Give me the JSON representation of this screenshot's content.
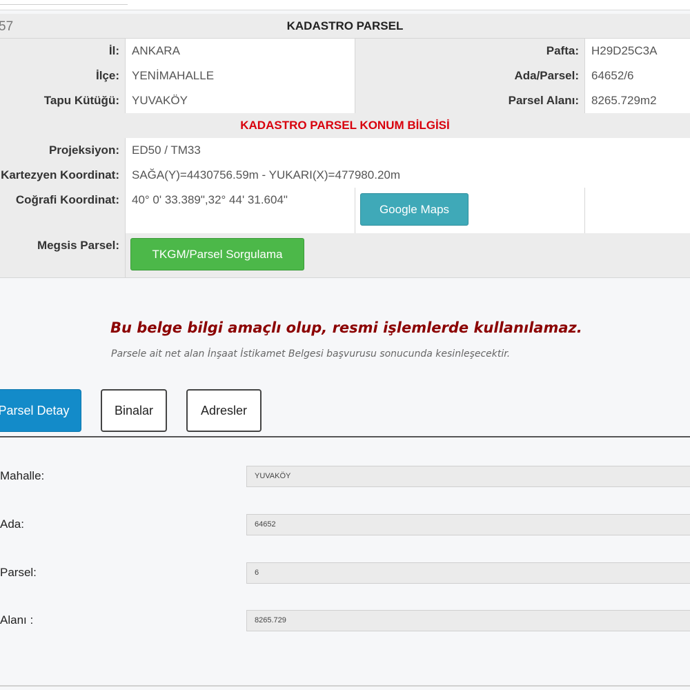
{
  "kadastro": {
    "row_number": "57",
    "title": "KADASTRO PARSEL",
    "il_label": "İl:",
    "il_value": "ANKARA",
    "ilce_label": "İlçe:",
    "ilce_value": "YENİMAHALLE",
    "tapu_label": "Tapu Kütüğü:",
    "tapu_value": "YUVAKÖY",
    "pafta_label": "Pafta:",
    "pafta_value": "H29D25C3A",
    "adaparsel_label": "Ada/Parsel:",
    "adaparsel_value": "64652/6",
    "alan_label": "Parsel Alanı:",
    "alan_value": "8265.729m2"
  },
  "konum": {
    "title": "KADASTRO PARSEL KONUM BİLGİSİ",
    "projeksiyon_label": "Projeksiyon:",
    "projeksiyon_value": "ED50 / TM33",
    "kartezyen_label": "Kartezyen Koordinat:",
    "kartezyen_value": "SAĞA(Y)=4430756.59m - YUKARI(X)=477980.20m",
    "cografi_label": "Coğrafi Koordinat:",
    "cografi_value": "40° 0' 33.389\",32° 44' 31.604\"",
    "google_button": "Google Maps",
    "megsis_label": "Megsis Parsel:",
    "tkgm_button": "TKGM/Parsel Sorgulama"
  },
  "notice": {
    "warning": "Bu belge bilgi amaçlı olup, resmi işlemlerde kullanılamaz.",
    "subtext": "Parsele ait net alan İnşaat İstikamet Belgesi başvurusu sonucunda kesinleşecektir."
  },
  "tabs": {
    "parsel_detay": "Parsel Detay",
    "binalar": "Binalar",
    "adresler": "Adresler"
  },
  "detail": {
    "mahalle_label": "Mahalle:",
    "mahalle_value": "YUVAKÖY",
    "ada_label": "Ada:",
    "ada_value": "64652",
    "parsel_label": "Parsel:",
    "parsel_value": "6",
    "alan_label": "Alanı :",
    "alan_value": "8265.729"
  }
}
